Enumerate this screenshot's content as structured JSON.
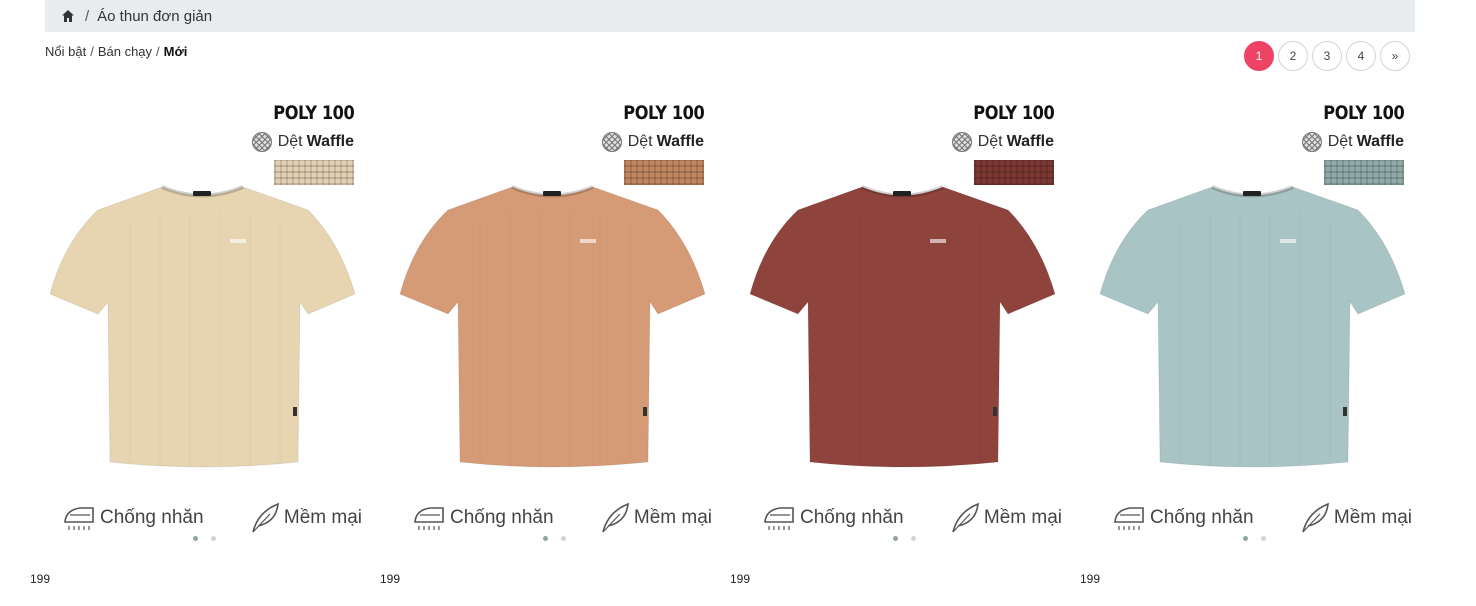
{
  "breadcrumb": {
    "home_icon": "home-icon",
    "separator": "/",
    "title": "Áo thun đơn giản"
  },
  "sort": {
    "items": [
      "Nổi bật",
      "Bán chạy",
      "Mới"
    ],
    "active": "Mới"
  },
  "pagination": {
    "pages": [
      "1",
      "2",
      "3",
      "4"
    ],
    "next": "»",
    "active": "1",
    "active_color": "#ee4266"
  },
  "products": [
    {
      "tag": "POLY 100",
      "weave_prefix": "Dệt",
      "weave_name": "Waffle",
      "color": "#e7d5b1",
      "swatch_color": "#e2d0b3",
      "feature1": "Chống nhăn",
      "feature2": "Mềm mại",
      "price": "199"
    },
    {
      "tag": "POLY 100",
      "weave_prefix": "Dệt",
      "weave_name": "Waffle",
      "color": "#d59b76",
      "swatch_color": "#c0865f",
      "feature1": "Chống nhăn",
      "feature2": "Mềm mại",
      "price": "199"
    },
    {
      "tag": "POLY 100",
      "weave_prefix": "Dệt",
      "weave_name": "Waffle",
      "color": "#8f433d",
      "swatch_color": "#7c3832",
      "feature1": "Chống nhăn",
      "feature2": "Mềm mại",
      "price": "199"
    },
    {
      "tag": "POLY 100",
      "weave_prefix": "Dệt",
      "weave_name": "Waffle",
      "color": "#a9c4c5",
      "swatch_color": "#90aaa9",
      "feature1": "Chống nhăn",
      "feature2": "Mềm mại",
      "price": "199"
    }
  ]
}
